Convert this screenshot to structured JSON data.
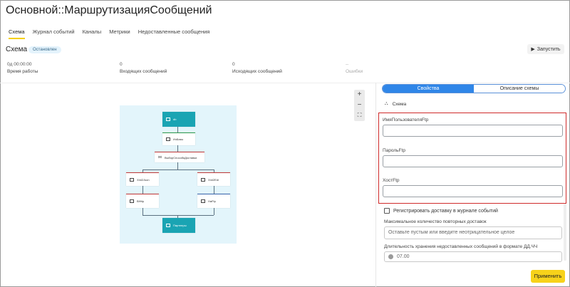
{
  "window": {
    "title": "Основной::МаршрутизацияСообщений"
  },
  "tabs": [
    "Схема",
    "Журнал событий",
    "Каналы",
    "Метрики",
    "Недоставленные сообщения"
  ],
  "section": {
    "title": "Схема",
    "status": "Остановлен"
  },
  "toolbar": {
    "start_label": "Запустить"
  },
  "metrics": {
    "uptime": {
      "value": "0д 00:00:00",
      "label": "Время работы"
    },
    "incoming": {
      "value": "0",
      "label": "Входящих сообщений"
    },
    "outgoing": {
      "value": "0",
      "label": "Исходящих сообщений"
    },
    "errors": {
      "value": "--",
      "label": "Ошибки"
    }
  },
  "zoom": {
    "in": "+",
    "out": "−",
    "fit": "⛶"
  },
  "diagram": {
    "nodes": {
      "db": "db",
      "izbazy": "ИзБазы",
      "choose": "ВыборСпособаДоставки",
      "xml2json": "Xml2Json",
      "xml2edi": "Xml2Edi",
      "vhttp": "ВHttp",
      "naftp": "НаFtp",
      "partners": "Партнеры"
    }
  },
  "panel": {
    "tab_properties": "Свойства",
    "tab_description": "Описание схемы",
    "schema_label": "Схема",
    "fields": {
      "user_label": "ИмяПользователяFtp",
      "password_label": "ПарольFtp",
      "host_label": "ХостFtp"
    },
    "register_checkbox": "Регистрировать доставку в журнале событий",
    "retries_label": "Максимальное количество повторных доставок",
    "retries_placeholder": "Оставьте пустым или введите неотрицательное целое",
    "storage_label": "Длительность хранения недоставленных сообщений в формате ДД.ЧЧ",
    "storage_value": "07.00"
  },
  "footer": {
    "apply_label": "Применить"
  }
}
